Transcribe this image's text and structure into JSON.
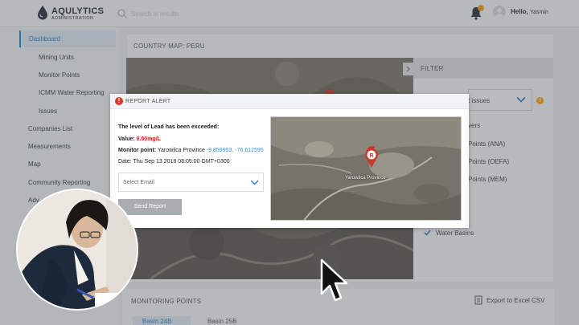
{
  "header": {
    "logo_name": "AQULYTICS",
    "logo_sub": "ADMINISTRATION",
    "search_placeholder": "Search in results",
    "greeting": "Hello,",
    "user_name": "Yasmin"
  },
  "sidebar": {
    "items": [
      {
        "label": "Dashboard",
        "active": true
      },
      {
        "label": "Mining Units"
      },
      {
        "label": "Monitor Points"
      },
      {
        "label": "ICMM Water Reporting"
      },
      {
        "label": "Issues"
      },
      {
        "label": "Companies List"
      },
      {
        "label": "Measurements"
      },
      {
        "label": "Map"
      },
      {
        "label": "Community Reporting"
      },
      {
        "label": "Adv"
      }
    ]
  },
  "map_panel": {
    "title": "COUNTRY MAP: PERU"
  },
  "filter": {
    "title": "FILTER",
    "select_value": "t issues",
    "warn_glyph": "!",
    "options": [
      {
        "label": "vers"
      },
      {
        "label": "Points (ANA)"
      },
      {
        "label": "Points (OEFA)"
      },
      {
        "label": "Points (MEM)"
      },
      {
        "label": "Water Basins",
        "checked": true
      }
    ]
  },
  "monitoring": {
    "title": "MONITORING POINTS",
    "export_label": "Export to Excel CSV",
    "tabs": [
      {
        "label": "Basin 24B",
        "active": true
      },
      {
        "label": "Basin 25B"
      }
    ]
  },
  "modal": {
    "title": "REPORT ALERT",
    "alert_glyph": "!",
    "headline": "The level of Lead has been exceeded:",
    "value_label": "Value:",
    "value": "0.80mg/L",
    "monitor_label": "Monitor point:",
    "monitor_place": "Yarowilca Province",
    "monitor_coords": "-9.859953, -76.612595",
    "date_label": "Date:",
    "date_value": "Thu Sep 13 2018 08:05:00 GMT+0300",
    "email_placeholder": "Select Email",
    "send_label": "Send Report",
    "map_marker_letter": "R",
    "map_label": "Yarowilca Province"
  },
  "colors": {
    "accent": "#2c7fc1",
    "alert_red": "#d63a2a",
    "value_red": "#d0251a",
    "warning": "#f2a31b",
    "coords_blue": "#3d8ed4"
  }
}
